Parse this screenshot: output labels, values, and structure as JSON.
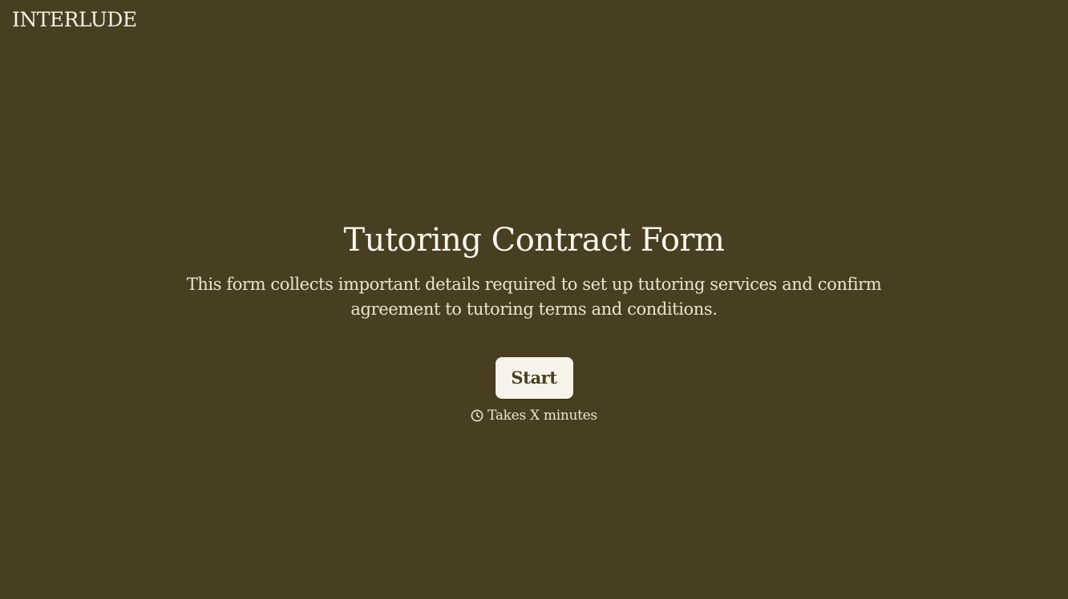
{
  "brand": {
    "name": "INTERLUDE"
  },
  "form": {
    "title": "Tutoring Contract Form",
    "description": "This form collects important details required to set up tutoring services and confirm agreement to tutoring terms and conditions.",
    "start_label": "Start",
    "duration_label": "Takes X minutes",
    "duration_icon": "clock-icon"
  },
  "colors": {
    "background": "#483e22",
    "text": "#f7f1e6",
    "button_background": "#f8f3ea",
    "button_text": "#483e22"
  }
}
